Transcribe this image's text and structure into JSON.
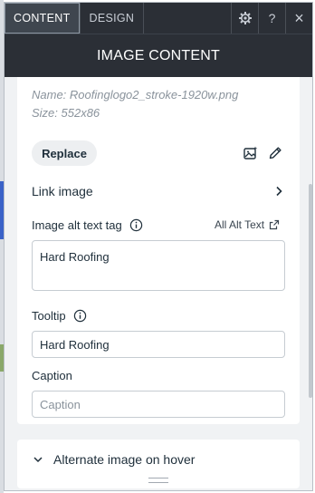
{
  "tabs": [
    {
      "label": "CONTENT",
      "active": true
    },
    {
      "label": "DESIGN",
      "active": false
    }
  ],
  "toolbar": {
    "settings_icon": "gear-icon",
    "help_label": "?",
    "close_label": "×"
  },
  "header": {
    "title": "IMAGE CONTENT"
  },
  "image": {
    "name": "Name: Roofinglogo2_stroke-1920w.png",
    "size": "Size: 552x86",
    "replace_label": "Replace"
  },
  "link": {
    "label": "Link image"
  },
  "alt": {
    "label": "Image alt text tag",
    "all_alt_label": "All Alt Text",
    "value": "Hard Roofing"
  },
  "tooltip": {
    "label": "Tooltip",
    "value": "Hard Roofing"
  },
  "caption": {
    "label": "Caption",
    "value": "",
    "placeholder": "Caption"
  },
  "hover": {
    "label": "Alternate image on hover"
  },
  "colors": {
    "header_bg": "#2b2f36",
    "panel_bg": "#f0f2f4",
    "text": "#20303c"
  }
}
